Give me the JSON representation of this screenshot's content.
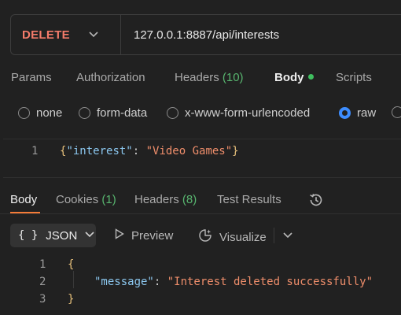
{
  "request": {
    "method": "DELETE",
    "url": "127.0.0.1:8887/api/interests"
  },
  "request_tabs": {
    "params": "Params",
    "authorization": "Authorization",
    "headers": "Headers",
    "headers_count": "(10)",
    "body": "Body",
    "scripts": "Scripts"
  },
  "body_types": {
    "none": "none",
    "form_data": "form-data",
    "urlencoded": "x-www-form-urlencoded",
    "raw": "raw",
    "selected": "raw"
  },
  "request_body": {
    "line_number": "1",
    "open": "{",
    "key": "\"interest\"",
    "colon": ": ",
    "value": "\"Video Games\"",
    "close": "}"
  },
  "response_tabs": {
    "body": "Body",
    "cookies": "Cookies",
    "cookies_count": "(1)",
    "headers": "Headers",
    "headers_count": "(8)",
    "test_results": "Test Results"
  },
  "response_toolbar": {
    "format_braces": "{ }",
    "format_label": "JSON",
    "preview_label": "Preview",
    "visualize_label": "Visualize"
  },
  "response_body": {
    "line_numbers": [
      "1",
      "2",
      "3"
    ],
    "open": "{",
    "key": "\"message\"",
    "colon": ": ",
    "value": "\"Interest deleted successfully\"",
    "close": "}"
  },
  "colors": {
    "method_delete": "#f47b6a",
    "accent_orange": "#f47b38",
    "count_green": "#58b56f",
    "radio_blue": "#3d8dff"
  }
}
